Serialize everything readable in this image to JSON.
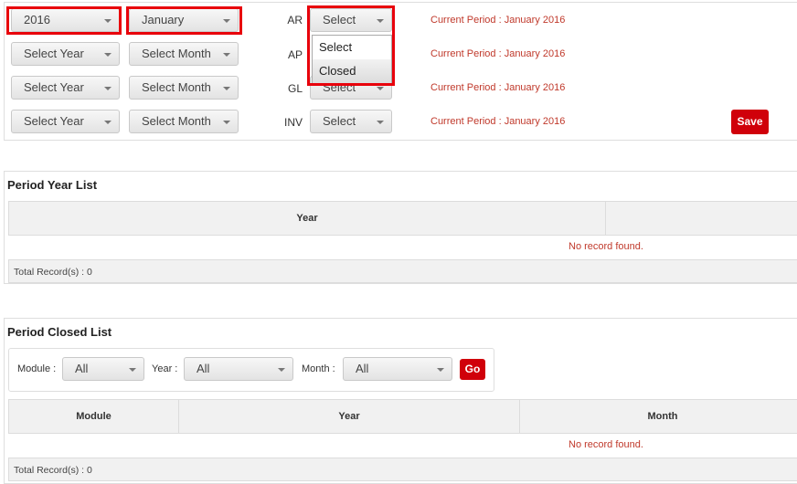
{
  "period_setup": {
    "rows": [
      {
        "year": "2016",
        "month": "January",
        "module": "AR",
        "status": "Select",
        "current_period": "Current Period : January 2016"
      },
      {
        "year": "Select Year",
        "month": "Select Month",
        "module": "AP",
        "status": "Select",
        "current_period": "Current Period : January 2016"
      },
      {
        "year": "Select Year",
        "month": "Select Month",
        "module": "GL",
        "status": "Select",
        "current_period": "Current Period : January 2016"
      },
      {
        "year": "Select Year",
        "month": "Select Month",
        "module": "INV",
        "status": "Select",
        "current_period": "Current Period : January 2016"
      }
    ],
    "status_dropdown_options": [
      "Select",
      "Closed"
    ],
    "save_label": "Save"
  },
  "period_year_list": {
    "title": "Period Year List",
    "columns": [
      "Year",
      ""
    ],
    "empty_message": "No record found.",
    "total": "Total Record(s) : 0"
  },
  "period_closed_list": {
    "title": "Period Closed List",
    "filters": {
      "module_label": "Module :",
      "module_value": "All",
      "year_label": "Year :",
      "year_value": "All",
      "month_label": "Month :",
      "month_value": "All",
      "go_label": "Go"
    },
    "columns": [
      "Module",
      "Year",
      "Month"
    ],
    "empty_message": "No record found.",
    "total": "Total Record(s) : 0"
  },
  "colors": {
    "accent_red": "#d0000a",
    "highlight": "#e8000b",
    "period_text": "#c0392b"
  }
}
